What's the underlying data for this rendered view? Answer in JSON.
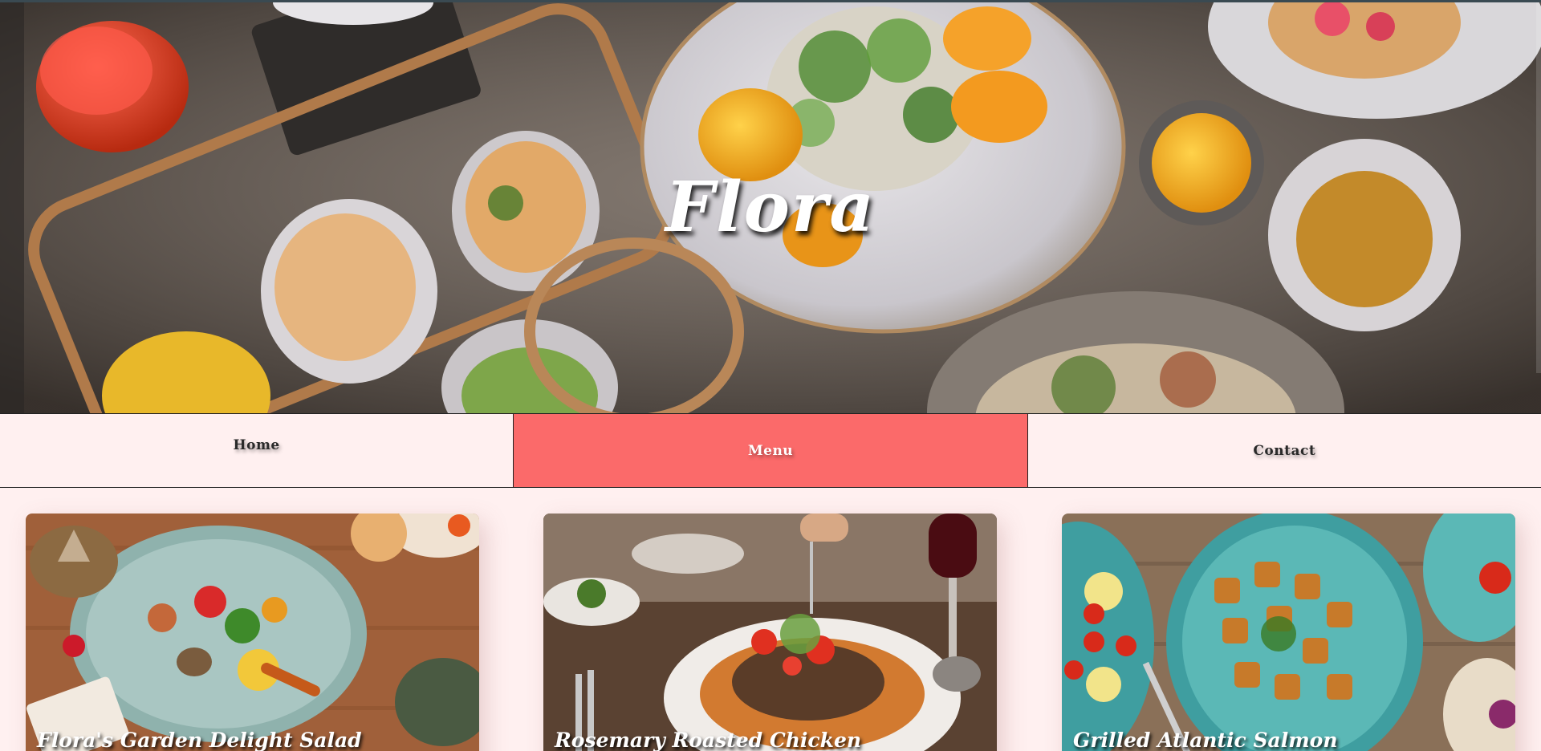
{
  "hero": {
    "title": "Flora"
  },
  "nav": {
    "items": [
      {
        "label": "Home"
      },
      {
        "label": "Menu"
      },
      {
        "label": "Contact"
      }
    ],
    "active_index": 1
  },
  "cards": [
    {
      "title": "Flora's Garden Delight Salad"
    },
    {
      "title": "Rosemary Roasted Chicken"
    },
    {
      "title": "Grilled Atlantic Salmon"
    }
  ],
  "colors": {
    "page_background": "#fff0f0",
    "nav_active": "#fb6a6a",
    "title_text": "#ffffff"
  },
  "icons": [
    "hero-food-image",
    "dish-image"
  ]
}
